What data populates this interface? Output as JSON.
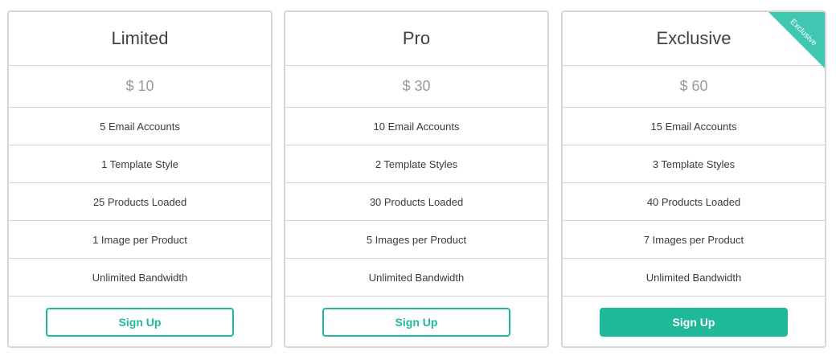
{
  "plans": [
    {
      "name": "Limited",
      "price": "$ 10",
      "features": [
        "5 Email Accounts",
        "1 Template Style",
        "25 Products Loaded",
        "1 Image per Product",
        "Unlimited Bandwidth"
      ],
      "button_label": "Sign Up",
      "button_style": "outline"
    },
    {
      "name": "Pro",
      "price": "$ 30",
      "features": [
        "10 Email Accounts",
        "2 Template Styles",
        "30 Products Loaded",
        "5 Images per Product",
        "Unlimited Bandwidth"
      ],
      "button_label": "Sign Up",
      "button_style": "outline"
    },
    {
      "name": "Exclusive",
      "price": "$ 60",
      "features": [
        "15 Email Accounts",
        "3 Template Styles",
        "40 Products Loaded",
        "7 Images per Product",
        "Unlimited Bandwidth"
      ],
      "button_label": "Sign Up",
      "button_style": "solid",
      "ribbon_label": "Exclusive"
    }
  ],
  "colors": {
    "accent": "#1fb99a",
    "ribbon": "#3fc7b2",
    "border": "#d7d7d7",
    "price_text": "#9a9a9a",
    "title_text": "#404040"
  }
}
